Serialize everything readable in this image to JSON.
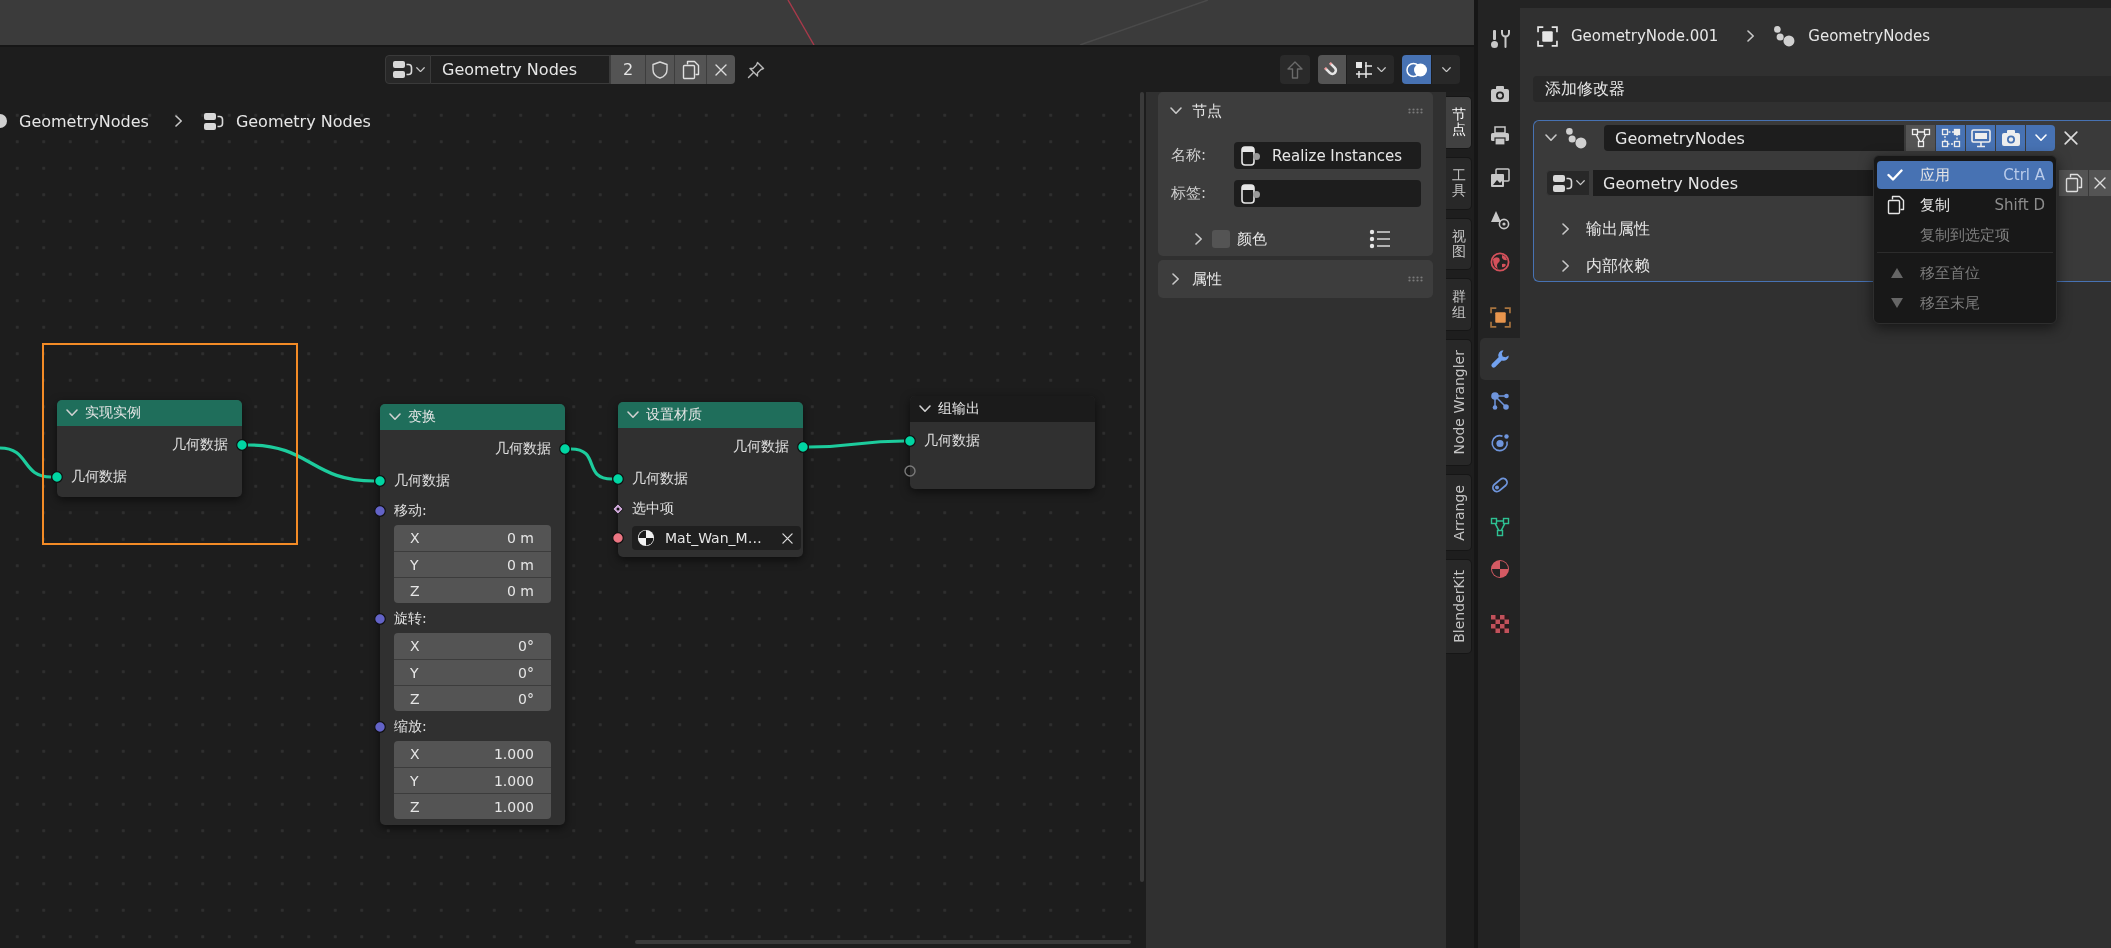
{
  "node_editor": {
    "header": {
      "tree_name": "Geometry Nodes",
      "users": "2",
      "fake_user": false,
      "pinned": false,
      "view_tools": [
        {
          "kind": "parent",
          "on": false
        },
        {
          "kind": "snap",
          "on": true
        },
        {
          "kind": "grid",
          "on": false
        },
        {
          "kind": "overlay",
          "on": true
        }
      ]
    },
    "breadcrumb": [
      {
        "kind": "modifier",
        "label": "GeometryNodes"
      },
      {
        "kind": "tree",
        "label": "Geometry Nodes"
      }
    ],
    "nodes": [
      {
        "title": "实现实例",
        "kind": "geometry",
        "expanded": true,
        "highlighted": true,
        "rows": [
          {
            "kind": "output",
            "label": "几何数据",
            "color": "#00d6a3",
            "linked": true
          },
          {
            "kind": "input",
            "label": "几何数据",
            "color": "#00d6a3",
            "linked": true
          }
        ]
      },
      {
        "title": "变换",
        "kind": "geometry",
        "expanded": true,
        "highlighted": false,
        "rows": [
          {
            "kind": "output",
            "label": "几何数据",
            "color": "#00d6a3",
            "linked": true
          },
          {
            "kind": "input",
            "label": "几何数据",
            "color": "#00d6a3",
            "linked": true
          },
          {
            "kind": "vector",
            "label": "移动:",
            "color": "#6363c7",
            "linked": false,
            "fields": [
              {
                "axis": "X",
                "value": "0 m"
              },
              {
                "axis": "Y",
                "value": "0 m"
              },
              {
                "axis": "Z",
                "value": "0 m"
              }
            ]
          },
          {
            "kind": "vector",
            "label": "旋转:",
            "color": "#6363c7",
            "linked": false,
            "fields": [
              {
                "axis": "X",
                "value": "0°"
              },
              {
                "axis": "Y",
                "value": "0°"
              },
              {
                "axis": "Z",
                "value": "0°"
              }
            ]
          },
          {
            "kind": "vector",
            "label": "缩放:",
            "color": "#6363c7",
            "linked": false,
            "fields": [
              {
                "axis": "X",
                "value": "1.000"
              },
              {
                "axis": "Y",
                "value": "1.000"
              },
              {
                "axis": "Z",
                "value": "1.000"
              }
            ]
          }
        ]
      },
      {
        "title": "设置材质",
        "kind": "geometry",
        "expanded": true,
        "highlighted": false,
        "rows": [
          {
            "kind": "output",
            "label": "几何数据",
            "color": "#00d6a3",
            "linked": true
          },
          {
            "kind": "input",
            "label": "几何数据",
            "color": "#00d6a3",
            "linked": true
          },
          {
            "kind": "field",
            "label": "选中项",
            "color": "#cca6d6",
            "linked": false
          },
          {
            "kind": "material",
            "value": "Mat_Wan_M…",
            "color": "#eb7582",
            "linked": false
          }
        ]
      },
      {
        "title": "组输出",
        "kind": "output",
        "expanded": true,
        "highlighted": false,
        "rows": [
          {
            "kind": "input",
            "label": "几何数据",
            "color": "#00d6a3",
            "linked": true
          },
          {
            "kind": "virtual",
            "linked": false
          }
        ]
      }
    ]
  },
  "sidebar": {
    "panels": [
      {
        "title": "节点",
        "expanded": true,
        "fields": [
          {
            "label": "名称:",
            "value": "Realize Instances"
          },
          {
            "label": "标签:"
          }
        ],
        "color": {
          "label": "颜色",
          "checked": false,
          "expanded": false
        }
      },
      {
        "title": "属性",
        "expanded": false
      }
    ],
    "tabs": [
      {
        "label": "节点",
        "selected": true
      },
      {
        "label": "工具",
        "selected": false
      },
      {
        "label": "视图",
        "selected": false
      },
      {
        "label": "群组",
        "selected": false
      },
      {
        "label": "Node Wrangler",
        "selected": false
      },
      {
        "label": "Arrange",
        "selected": false
      },
      {
        "label": "BlenderKit",
        "selected": false
      }
    ]
  },
  "properties": {
    "tab_groups": [
      {
        "tabs": [
          {
            "kind": "tool",
            "selected": false
          }
        ]
      },
      {
        "tabs": [
          {
            "kind": "render",
            "selected": false
          },
          {
            "kind": "output",
            "selected": false
          },
          {
            "kind": "viewlayer",
            "selected": false
          },
          {
            "kind": "scene",
            "selected": false
          },
          {
            "kind": "world",
            "selected": false
          }
        ]
      },
      {
        "tabs": [
          {
            "kind": "object",
            "selected": false
          },
          {
            "kind": "modifiers",
            "selected": true
          },
          {
            "kind": "particles",
            "selected": false
          },
          {
            "kind": "physics",
            "selected": false
          },
          {
            "kind": "constraints",
            "selected": false
          },
          {
            "kind": "data",
            "selected": false
          },
          {
            "kind": "material",
            "selected": false
          }
        ]
      },
      {
        "tabs": [
          {
            "kind": "texture",
            "selected": false
          }
        ]
      }
    ],
    "breadcrumb": [
      {
        "kind": "object",
        "label": "GeometryNode.001"
      },
      {
        "kind": "modifier",
        "label": "GeometryNodes"
      }
    ],
    "add_modifier": "添加修改器",
    "modifier": {
      "name": "GeometryNodes",
      "expanded": true,
      "toggles": [
        {
          "kind": "editmode",
          "on": false
        },
        {
          "kind": "cage",
          "on": true
        },
        {
          "kind": "viewport",
          "on": true
        },
        {
          "kind": "render",
          "on": true
        }
      ],
      "node_group": "Geometry Nodes",
      "subpanels": [
        {
          "title": "输出属性",
          "expanded": false
        },
        {
          "title": "内部依赖",
          "expanded": false
        }
      ],
      "menu": {
        "open": true,
        "groups": [
          {
            "items": [
              {
                "kind": "apply",
                "label": "应用",
                "shortcut": "Ctrl A",
                "selected": true,
                "disabled": false
              },
              {
                "kind": "duplicate",
                "label": "复制",
                "shortcut": "Shift D",
                "selected": false,
                "disabled": false
              },
              {
                "kind": "plain",
                "label": "复制到选定项",
                "selected": false,
                "disabled": true
              }
            ]
          },
          {
            "items": [
              {
                "kind": "first",
                "label": "移至首位",
                "selected": false,
                "disabled": true
              },
              {
                "kind": "last",
                "label": "移至末尾",
                "selected": false,
                "disabled": true
              }
            ]
          }
        ]
      }
    }
  }
}
